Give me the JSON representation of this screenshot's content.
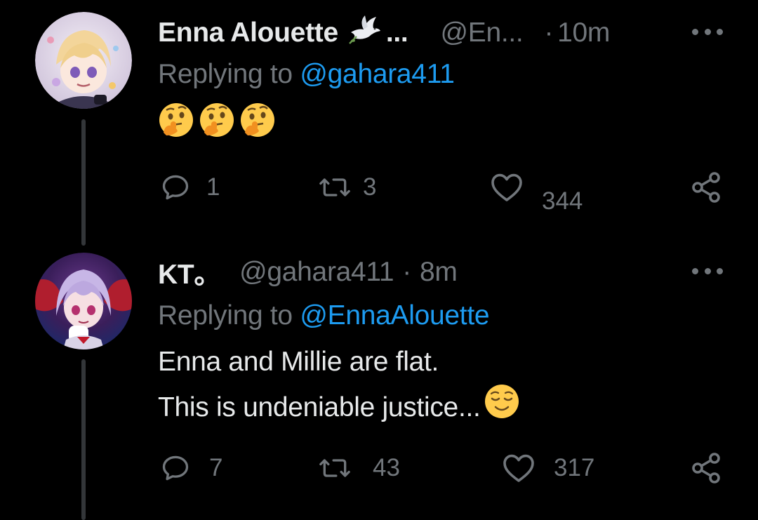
{
  "tweets": [
    {
      "display_name": "Enna Alouette",
      "badge_icon": "dove-icon",
      "name_ellipsis": "...",
      "handle": "@En...",
      "separator": "·",
      "time": "10m",
      "replying_prefix": "Replying to",
      "replying_to": "@gahara411",
      "body_emojis": [
        "thinking-face-emoji",
        "thinking-face-emoji",
        "thinking-face-emoji"
      ],
      "replies": "1",
      "retweets": "3",
      "likes": "344"
    },
    {
      "display_name": "KT。",
      "handle": "@gahara411",
      "separator": "·",
      "time": "8m",
      "replying_prefix": "Replying to",
      "replying_to": "@EnnaAlouette",
      "body_line1": "Enna and Millie are flat.",
      "body_line2": "This is undeniable justice...",
      "body_emoji": "relieved-face-emoji",
      "replies": "7",
      "retweets": "43",
      "likes": "317"
    }
  ],
  "colors": {
    "background": "#000000",
    "text": "#e7e9ea",
    "muted": "#71767b",
    "link": "#1d9bf0",
    "thread_line": "#333639"
  }
}
